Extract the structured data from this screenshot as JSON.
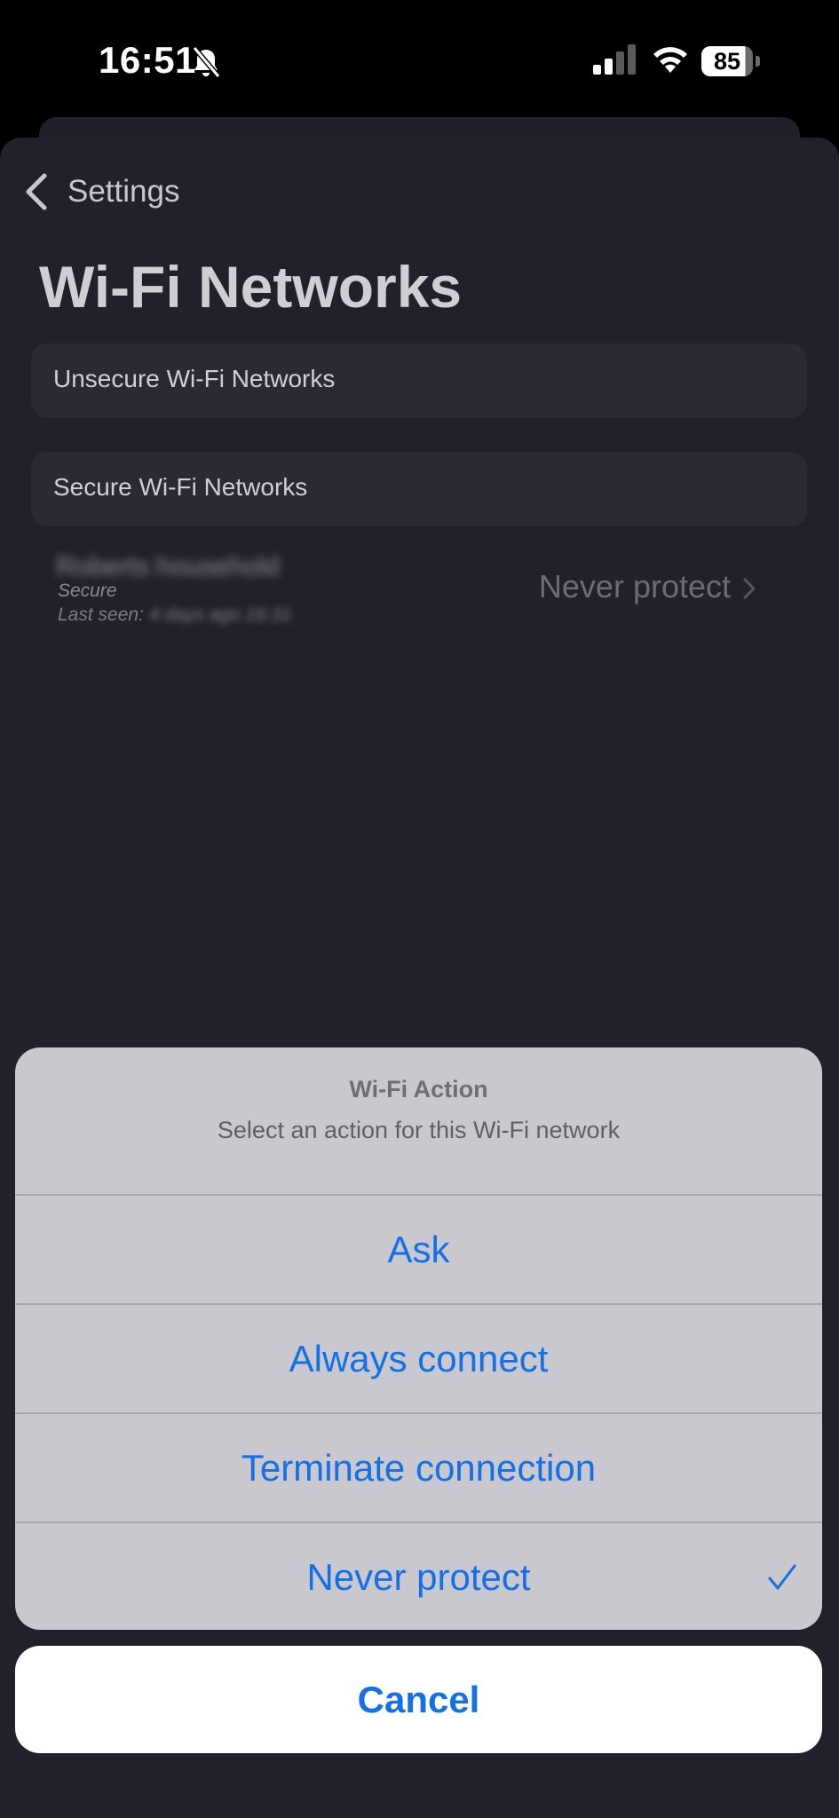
{
  "status_bar": {
    "time": "16:51",
    "battery": "85"
  },
  "nav": {
    "back_label": "Settings"
  },
  "page": {
    "title": "Wi-Fi Networks"
  },
  "sections": {
    "unsecure_label": "Unsecure Wi-Fi Networks",
    "secure_label": "Secure Wi-Fi Networks"
  },
  "network": {
    "name": "Roberts household",
    "status": "Secure",
    "last_seen_label": "Last seen:",
    "last_seen_value": "4 days ago 16:31",
    "action": "Never protect"
  },
  "action_sheet": {
    "title": "Wi-Fi Action",
    "subtitle": "Select an action for this Wi-Fi network",
    "options": [
      {
        "label": "Ask"
      },
      {
        "label": "Always connect"
      },
      {
        "label": "Terminate connection"
      },
      {
        "label": "Never protect",
        "selected": true
      }
    ],
    "cancel_label": "Cancel"
  },
  "colors": {
    "accent": "#1470e6",
    "background": "#21212b",
    "sheet": "#c8c8ce"
  },
  "icons": [
    "bell-slash-icon",
    "signal-icon",
    "wifi-icon",
    "battery-icon",
    "chevron-left-icon",
    "chevron-right-icon",
    "checkmark-icon"
  ]
}
